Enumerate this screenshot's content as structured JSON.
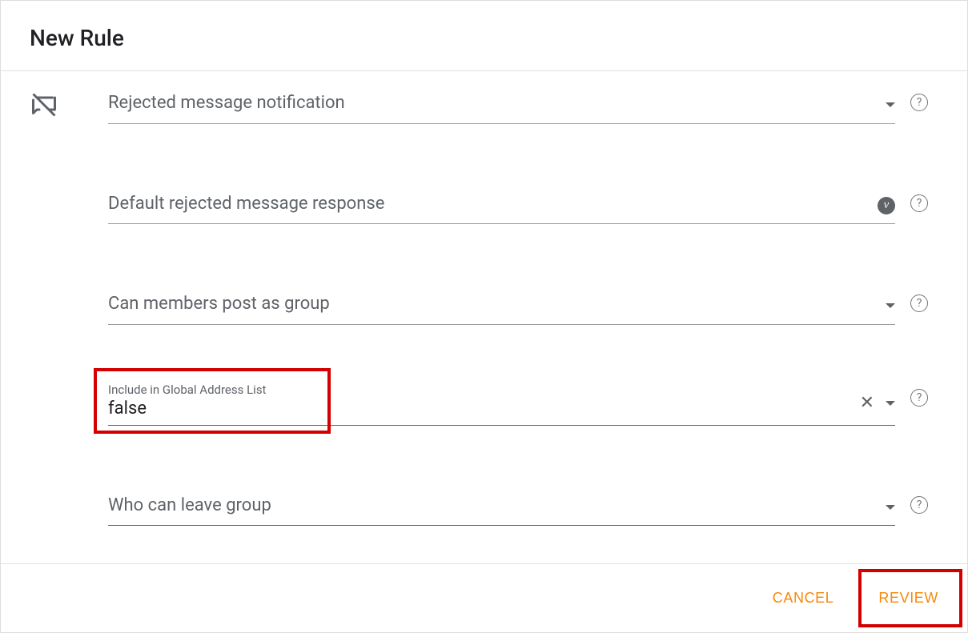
{
  "dialog": {
    "title": "New Rule"
  },
  "fields": {
    "rejected_notification": {
      "label": "Rejected message notification"
    },
    "default_rejected_response": {
      "label": "Default rejected message response"
    },
    "post_as_group": {
      "label": "Can members post as group"
    },
    "include_gal": {
      "small_label": "Include in Global Address List",
      "value": "false"
    },
    "who_can_leave": {
      "label": "Who can leave group"
    }
  },
  "footer": {
    "cancel": "CANCEL",
    "review": "REVIEW"
  }
}
